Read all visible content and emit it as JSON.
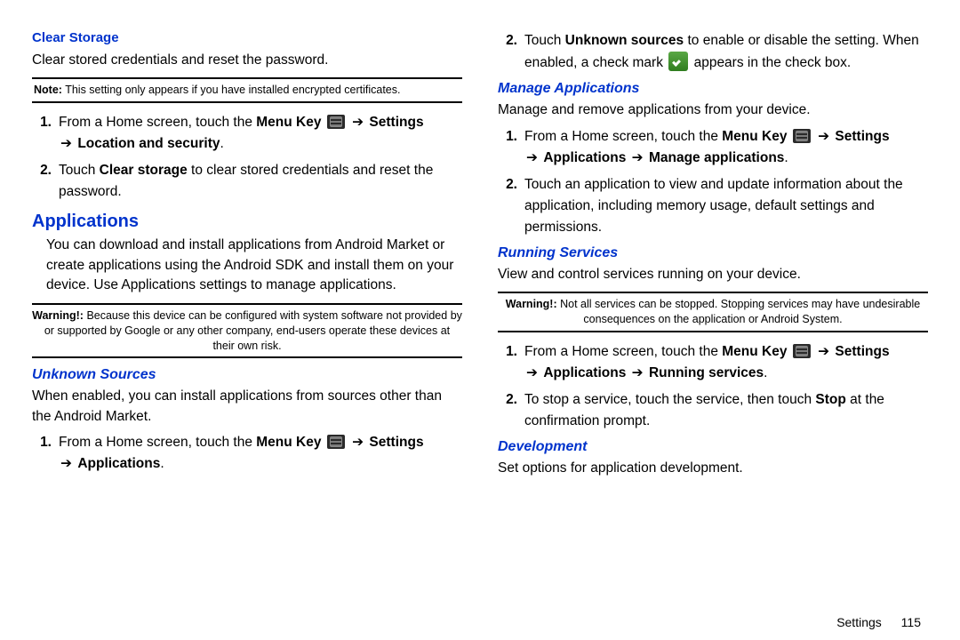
{
  "left": {
    "clearStorage": {
      "heading": "Clear Storage",
      "body": "Clear stored credentials and reset the password.",
      "noteLead": "Note:",
      "note": " This setting only appears if you have installed encrypted certificates.",
      "step1_a": "From a Home screen, touch the ",
      "step1_menuKey": "Menu Key",
      "step1_b": " ",
      "step1_settings": "Settings",
      "step1_c": " ",
      "step1_loc": "Location and security",
      "step2_a": "Touch ",
      "step2_clear": "Clear storage",
      "step2_b": " to clear stored credentials and reset the password."
    },
    "applications": {
      "heading": "Applications",
      "body": "You can download and install applications from Android Market or create applications using the Android SDK and install them on your device. Use Applications settings to manage applications.",
      "warnLead": "Warning!:",
      "warn": " Because this device can be configured with system software not provided by or supported by Google or any other company, end-users operate these devices at their own risk."
    },
    "unknown": {
      "heading": "Unknown Sources",
      "body": "When enabled, you can install applications from sources other than the Android Market.",
      "step1_a": "From a Home screen, touch the ",
      "step1_menuKey": "Menu Key",
      "step1_settings": "Settings",
      "step1_apps": "Applications"
    }
  },
  "right": {
    "unknownCont": {
      "step2_a": "Touch ",
      "step2_us": "Unknown sources",
      "step2_b": " to enable or disable the setting. When enabled, a check mark ",
      "step2_c": " appears in the check box."
    },
    "manage": {
      "heading": "Manage Applications",
      "body": "Manage and remove applications from your device.",
      "step1_a": "From a Home screen, touch the ",
      "step1_menuKey": "Menu Key",
      "step1_settings": "Settings",
      "step1_apps": "Applications",
      "step1_manage": "Manage applications",
      "step2": "Touch an application to view and update information about the application, including memory usage, default settings and permissions."
    },
    "running": {
      "heading": "Running Services",
      "body": "View and control services running on your device.",
      "warnLead": "Warning!:",
      "warn": " Not all services can be stopped. Stopping services may have undesirable consequences on the application or Android System.",
      "step1_a": "From a Home screen, touch the ",
      "step1_menuKey": "Menu Key",
      "step1_settings": "Settings",
      "step1_apps": "Applications",
      "step1_run": "Running services",
      "step2_a": "To stop a service, touch the service, then touch ",
      "step2_stop": "Stop",
      "step2_b": " at the confirmation prompt."
    },
    "development": {
      "heading": "Development",
      "body": "Set options for application development."
    }
  },
  "footer": {
    "section": "Settings",
    "page": "115"
  }
}
